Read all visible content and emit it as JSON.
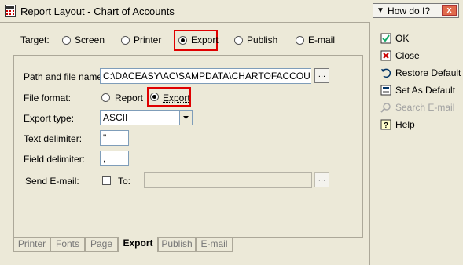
{
  "window": {
    "title": "Report Layout - Chart of Accounts",
    "how_do_i": "How do I?",
    "close_glyph": "x"
  },
  "target": {
    "label": "Target:",
    "options": [
      "Screen",
      "Printer",
      "Export",
      "Publish",
      "E-mail"
    ],
    "selected": "Export"
  },
  "form": {
    "path_label": "Path and file name:",
    "path_value": "C:\\DACEASY\\AC\\SAMPDATA\\CHARTOFACCOUNTS",
    "browse_label": "...",
    "file_format_label": "File format:",
    "file_format_options": [
      "Report",
      "Export"
    ],
    "file_format_selected": "Export",
    "export_type_label": "Export type:",
    "export_type_value": "ASCII",
    "text_delim_label": "Text delimiter:",
    "text_delim_value": "\"",
    "field_delim_label": "Field delimiter:",
    "field_delim_value": ",",
    "send_email_label": "Send E-mail:",
    "to_label": "To:",
    "to_value": "",
    "to_browse_label": "..."
  },
  "tabs": [
    "Printer",
    "Fonts",
    "Page",
    "Export",
    "Publish",
    "E-mail"
  ],
  "active_tab": "Export",
  "actions": [
    {
      "label": "OK",
      "icon": "ok-icon",
      "enabled": true
    },
    {
      "label": "Close",
      "icon": "close-icon",
      "enabled": true
    },
    {
      "label": "Restore Default",
      "icon": "restore-icon",
      "enabled": true
    },
    {
      "label": "Set As Default",
      "icon": "set-default-icon",
      "enabled": true
    },
    {
      "label": "Search E-mail",
      "icon": "search-email-icon",
      "enabled": false
    },
    {
      "label": "Help",
      "icon": "help-icon",
      "enabled": true
    }
  ],
  "colors": {
    "background": "#ece9d8",
    "highlight": "#e00000",
    "field_border": "#7f9db9"
  }
}
